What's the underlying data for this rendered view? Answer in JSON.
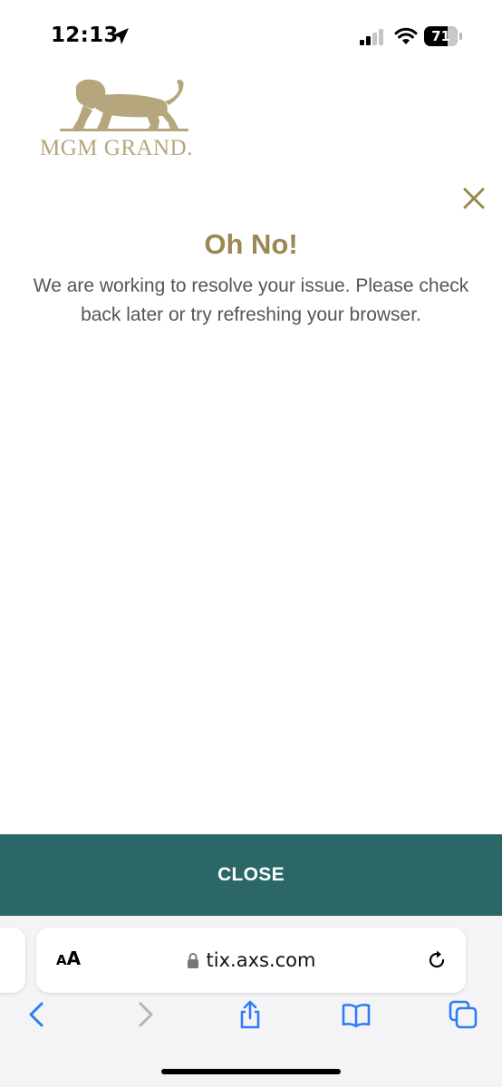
{
  "status_bar": {
    "time": "12:13",
    "battery_level": "71",
    "battery_fraction": 0.71,
    "signal_bars_active": 2,
    "icons": [
      "location-arrow-icon",
      "cellular-signal-icon",
      "wifi-icon",
      "battery-icon"
    ]
  },
  "logo": {
    "text": "MGM GRAND.",
    "icon": "lion-icon",
    "color": "#b5a67d"
  },
  "modal": {
    "heading": "Oh No!",
    "message": "We are working to resolve your issue. Please check back later or try refreshing your browser.",
    "close_icon": "close-icon",
    "heading_color": "#9c8753",
    "close_button_label": "CLOSE",
    "close_button_color": "#2b6766"
  },
  "browser": {
    "reader_button_label_small": "A",
    "reader_button_label_big": "A",
    "url": "tix.axs.com",
    "toolbar": [
      "back-icon",
      "forward-icon",
      "share-icon",
      "bookmarks-icon",
      "tabs-icon"
    ],
    "accent_color": "#2f7cf6"
  }
}
